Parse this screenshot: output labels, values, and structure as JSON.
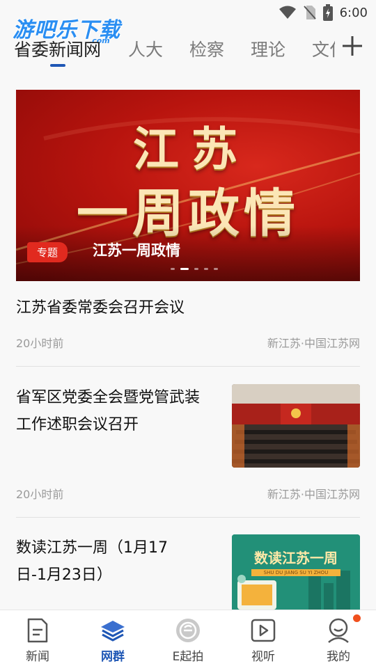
{
  "status_bar": {
    "time": "6:00"
  },
  "watermark": {
    "text": "游吧乐下载",
    "sub": ".com"
  },
  "tabs": [
    {
      "label": "省委新闻网",
      "active": true
    },
    {
      "label": "人大",
      "active": false
    },
    {
      "label": "检察",
      "active": false
    },
    {
      "label": "理论",
      "active": false
    },
    {
      "label": "文化",
      "active": false
    }
  ],
  "banner": {
    "title_line1": "江苏",
    "title_line2": "一周政情",
    "badge": "专题",
    "caption": "江苏一周政情",
    "slide_count": 5,
    "active_slide": 1
  },
  "articles": [
    {
      "title": "江苏省委常委会召开会议",
      "time": "20小时前",
      "source": "新江苏·中国江苏网"
    },
    {
      "title": "省军区党委全会暨党管武装工作述职会议召开",
      "time": "20小时前",
      "source": "新江苏·中国江苏网"
    },
    {
      "title": "数读江苏一周（1月17日-1月23日）",
      "thumb_text": "数读江苏一周",
      "thumb_sub": "SHU DU JIANG SU YI ZHOU"
    }
  ],
  "bottom_nav": [
    {
      "label": "新闻",
      "icon": "document-icon",
      "active": false
    },
    {
      "label": "网群",
      "icon": "layers-icon",
      "active": true
    },
    {
      "label": "E起拍",
      "icon": "e-circle-icon",
      "active": false
    },
    {
      "label": "视听",
      "icon": "play-icon",
      "active": false
    },
    {
      "label": "我的",
      "icon": "user-icon",
      "active": false,
      "badge": true
    }
  ],
  "colors": {
    "accent": "#1f57b5",
    "badge_red": "#e12a1f",
    "notify": "#f0501e"
  }
}
